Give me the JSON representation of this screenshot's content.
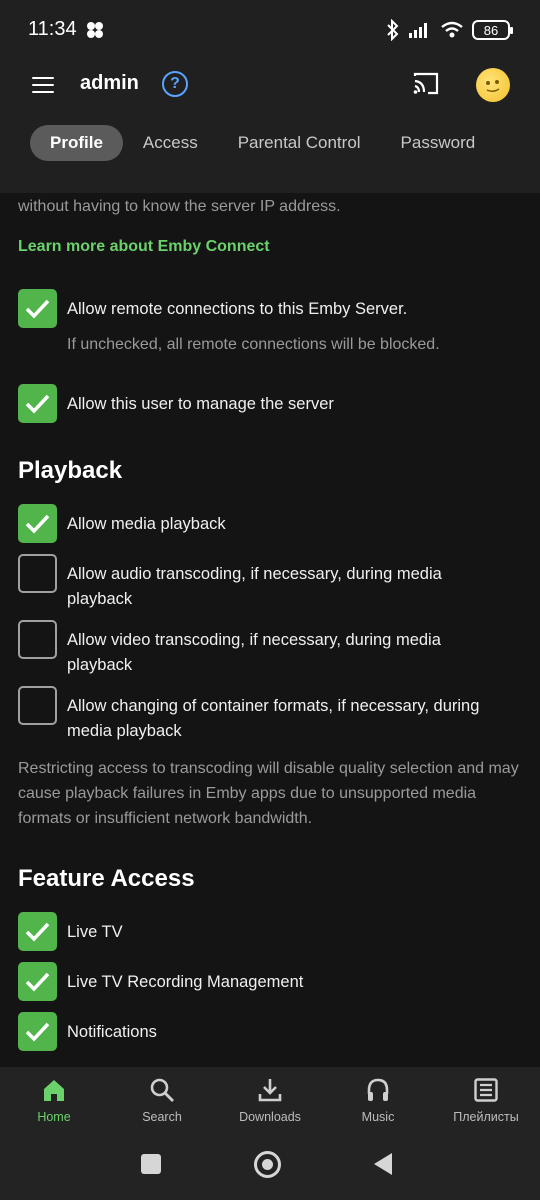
{
  "status_bar": {
    "time": "11:34",
    "battery": "86",
    "icons": [
      "cloud-dots-icon",
      "bluetooth-icon",
      "signal-icon",
      "wifi-icon",
      "battery-icon"
    ]
  },
  "header": {
    "title": "admin",
    "help": "?",
    "tabs": [
      {
        "label": "Profile",
        "active": true
      },
      {
        "label": "Access",
        "active": false
      },
      {
        "label": "Parental Control",
        "active": false
      },
      {
        "label": "Password",
        "active": false
      }
    ]
  },
  "content": {
    "partial_text": "without having to know the server IP address.",
    "learn_more_link": "Learn more about Emby Connect",
    "remote": {
      "label": "Allow remote connections to this Emby Server.",
      "sub": "If unchecked, all remote connections will be blocked.",
      "checked": true
    },
    "manage": {
      "label": "Allow this user to manage the server",
      "checked": true
    },
    "playback": {
      "title": "Playback",
      "items": [
        {
          "label": "Allow media playback",
          "checked": true
        },
        {
          "label": "Allow audio transcoding, if necessary, during media playback",
          "checked": false
        },
        {
          "label": "Allow video transcoding, if necessary, during media playback",
          "checked": false
        },
        {
          "label": "Allow changing of container formats, if necessary, during media playback",
          "checked": false
        }
      ],
      "note": "Restricting access to transcoding will disable quality selection and may cause playback failures in Emby apps due to unsupported media formats or insufficient network bandwidth."
    },
    "feature_access": {
      "title": "Feature Access",
      "items": [
        {
          "label": "Live TV",
          "checked": true
        },
        {
          "label": "Live TV Recording Management",
          "checked": true
        },
        {
          "label": "Notifications",
          "checked": true
        }
      ]
    }
  },
  "bottom_nav": [
    {
      "label": "Home",
      "icon": "home-icon",
      "active": true
    },
    {
      "label": "Search",
      "icon": "search-icon",
      "active": false
    },
    {
      "label": "Downloads",
      "icon": "download-icon",
      "active": false
    },
    {
      "label": "Music",
      "icon": "headphones-icon",
      "active": false
    },
    {
      "label": "Плейлисты",
      "icon": "playlist-icon",
      "active": false
    }
  ],
  "colors": {
    "accent_green": "#52b54b",
    "link_green": "#6bd16b",
    "help_blue": "#5aa3ff",
    "background": "#141414",
    "header_bg": "#202020"
  }
}
